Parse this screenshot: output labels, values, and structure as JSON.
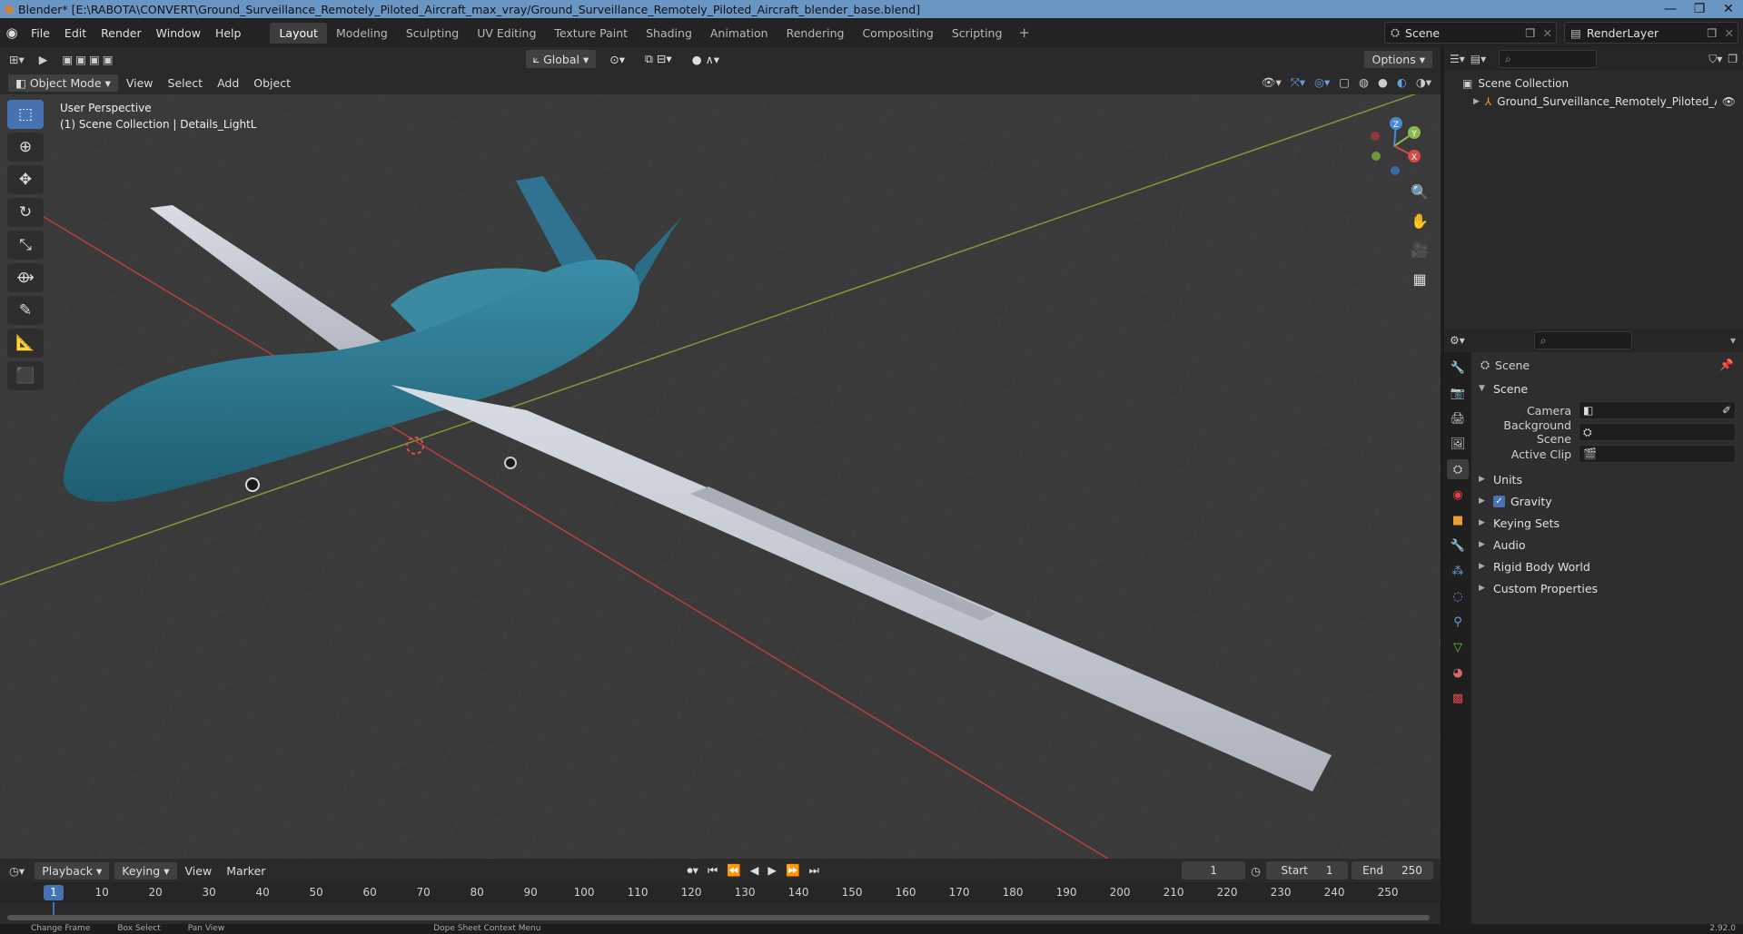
{
  "titlebar": {
    "title": "Blender* [E:\\RABOTA\\CONVERT\\Ground_Surveillance_Remotely_Piloted_Aircraft_max_vray/Ground_Surveillance_Remotely_Piloted_Aircraft_blender_base.blend]"
  },
  "menu": {
    "items": [
      "File",
      "Edit",
      "Render",
      "Window",
      "Help"
    ]
  },
  "workspaces": [
    "Layout",
    "Modeling",
    "Sculpting",
    "UV Editing",
    "Texture Paint",
    "Shading",
    "Animation",
    "Rendering",
    "Compositing",
    "Scripting"
  ],
  "active_workspace": "Layout",
  "scene": {
    "name": "Scene",
    "render_layer": "RenderLayer"
  },
  "viewport_header": {
    "transform": "Global",
    "options": "Options"
  },
  "viewport_menu": {
    "mode": "Object Mode",
    "items": [
      "View",
      "Select",
      "Add",
      "Object"
    ]
  },
  "viewport_overlay": {
    "line1": "User Perspective",
    "line2": "(1) Scene Collection | Details_LightL"
  },
  "gizmo": {
    "z": "Z",
    "y": "Y",
    "x": "X"
  },
  "outliner": {
    "collection": "Scene Collection",
    "object": "Ground_Surveillance_Remotely_Piloted_Airc"
  },
  "properties": {
    "context": "Scene",
    "panel": "Scene",
    "fields": [
      {
        "label": "Camera",
        "value": ""
      },
      {
        "label": "Background Scene",
        "value": ""
      },
      {
        "label": "Active Clip",
        "value": ""
      }
    ],
    "subpanels": [
      "Units",
      "Gravity",
      "Keying Sets",
      "Audio",
      "Rigid Body World",
      "Custom Properties"
    ]
  },
  "timeline": {
    "menus": [
      "Playback",
      "Keying",
      "View",
      "Marker"
    ],
    "current_frame": "1",
    "start_label": "Start",
    "start": "1",
    "end_label": "End",
    "end": "250",
    "ticks": [
      "1",
      "10",
      "20",
      "30",
      "40",
      "50",
      "60",
      "70",
      "80",
      "90",
      "100",
      "110",
      "120",
      "130",
      "140",
      "150",
      "160",
      "170",
      "180",
      "190",
      "200",
      "210",
      "220",
      "230",
      "240",
      "250"
    ]
  },
  "status": {
    "items": [
      "Change Frame",
      "Box Select",
      "Pan View",
      "Dope Sheet Context Menu"
    ],
    "version": "2.92.0"
  },
  "colors": {
    "accent": "#4772b3",
    "titlebar": "#6a96c4",
    "x_axis": "#d64a4a",
    "y_axis": "#8ab84a",
    "z_axis": "#4a8ad6",
    "drone_body": "#2f7a94",
    "wing": "#c8ccd4"
  }
}
